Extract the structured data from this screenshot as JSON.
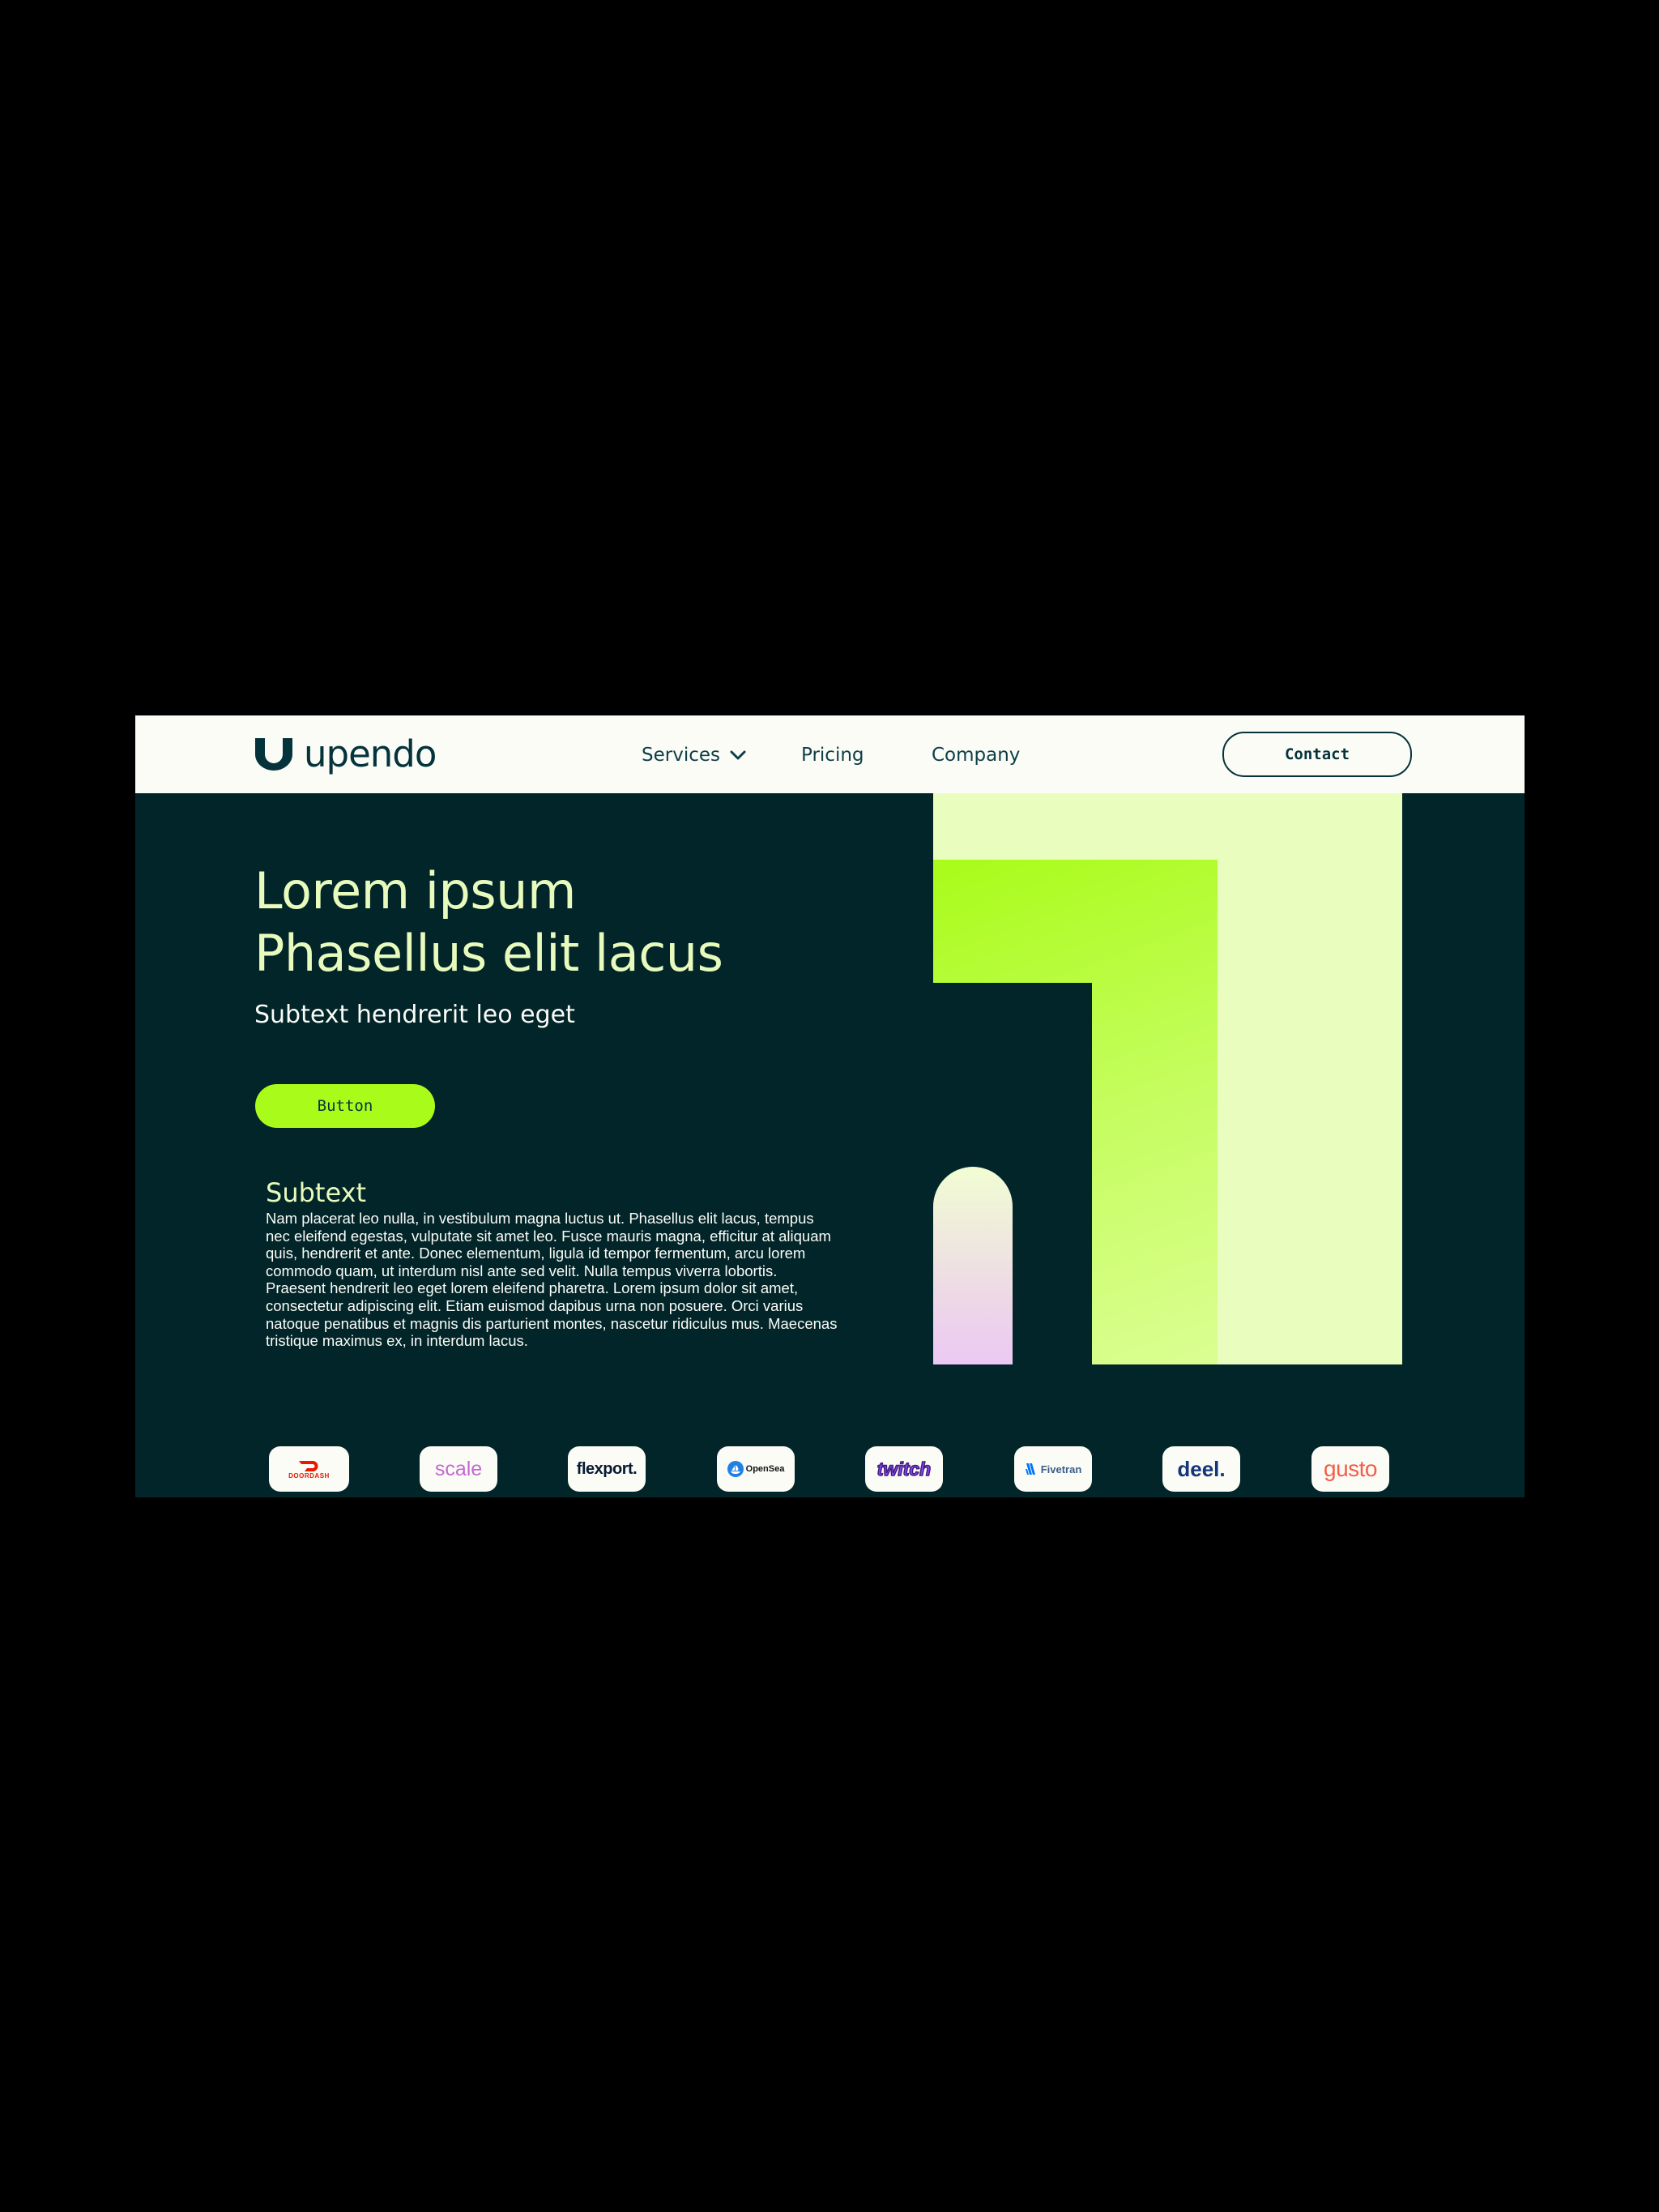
{
  "header": {
    "brand_name": "upendo",
    "nav": {
      "services": "Services",
      "pricing": "Pricing",
      "company": "Company"
    },
    "contact_label": "Contact"
  },
  "hero": {
    "title_line1": "Lorem ipsum",
    "title_line2": "Phasellus elit lacus",
    "subtitle": "Subtext hendrerit leo eget",
    "button_label": "Button",
    "sub_heading": "Subtext",
    "body": "Nam placerat leo nulla, in vestibulum magna luctus ut. Phasellus elit lacus, tempus nec eleifend egestas, vulputate sit amet leo. Fusce mauris magna, efficitur at aliquam quis, hendrerit et ante. Donec elementum, ligula id tempor fermentum, arcu lorem commodo quam, ut interdum nisl ante sed velit. Nulla tempus viverra lobortis. Praesent hendrerit leo eget lorem eleifend pharetra. Lorem ipsum dolor sit amet, consectetur adipiscing elit. Etiam euismod dapibus urna non posuere. Orci varius natoque penatibus et magnis dis parturient montes, nascetur ridiculus mus. Maecenas tristique maximus ex, in interdum lacus."
  },
  "logos": {
    "doordash": "DOORDASH",
    "scale": "scale",
    "flexport": "flexport.",
    "opensea": "OpenSea",
    "twitch": "twitch",
    "fivetran": "Fivetran",
    "deel": "deel.",
    "gusto": "gusto"
  },
  "colors": {
    "page_bg": "#000000",
    "header_bg": "#fbfcf6",
    "hero_bg": "#02252a",
    "accent": "#a9fc19",
    "title_text": "#e8fbbd",
    "pale_green": "#e9fdbf"
  }
}
